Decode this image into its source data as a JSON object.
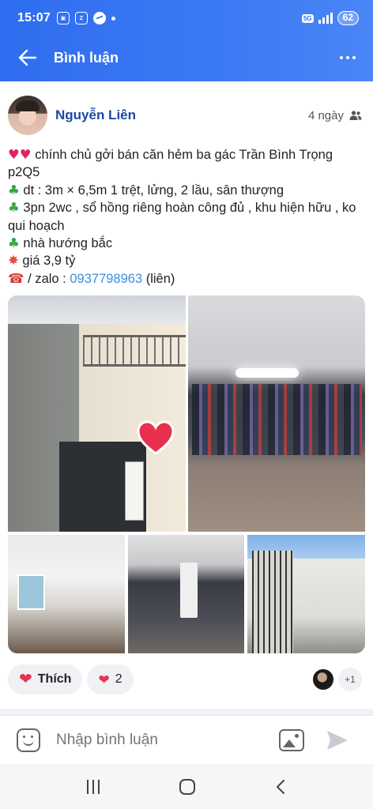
{
  "status_bar": {
    "time": "15:07",
    "network": "5G",
    "battery": "62"
  },
  "app_bar": {
    "title": "Bình luận"
  },
  "post": {
    "author": "Nguyễn Liên",
    "time": "4 ngày",
    "lines": [
      {
        "icon": "heart",
        "text": "chính chủ gởi bán căn hẻm ba gác Trần Bình Trọng p2Q5"
      },
      {
        "icon": "clover",
        "text": "dt : 3m × 6,5m 1 trệt, lửng, 2 lầu, sân thượng"
      },
      {
        "icon": "clover",
        "text": "3pn 2wc , sổ hồng riêng hoàn công đủ , khu hiện hữu , ko qui hoạch"
      },
      {
        "icon": "clover",
        "text": "nhà hướng bắc"
      },
      {
        "icon": "boom",
        "text": "giá 3,9 tỷ"
      }
    ],
    "contact_prefix": "/ zalo :",
    "phone": "0937798963",
    "contact_suffix": "(liên)",
    "photo_count": 5
  },
  "reactions": {
    "like_label": "Thích",
    "heart_count": "2",
    "extra_viewers": "+1"
  },
  "comment": {
    "placeholder": "Nhập bình luận"
  },
  "colors": {
    "header_blue": "#3b7af5",
    "author_blue": "#1d47a8",
    "link_blue": "#3d8fdf",
    "heart_red": "#e8304f"
  }
}
